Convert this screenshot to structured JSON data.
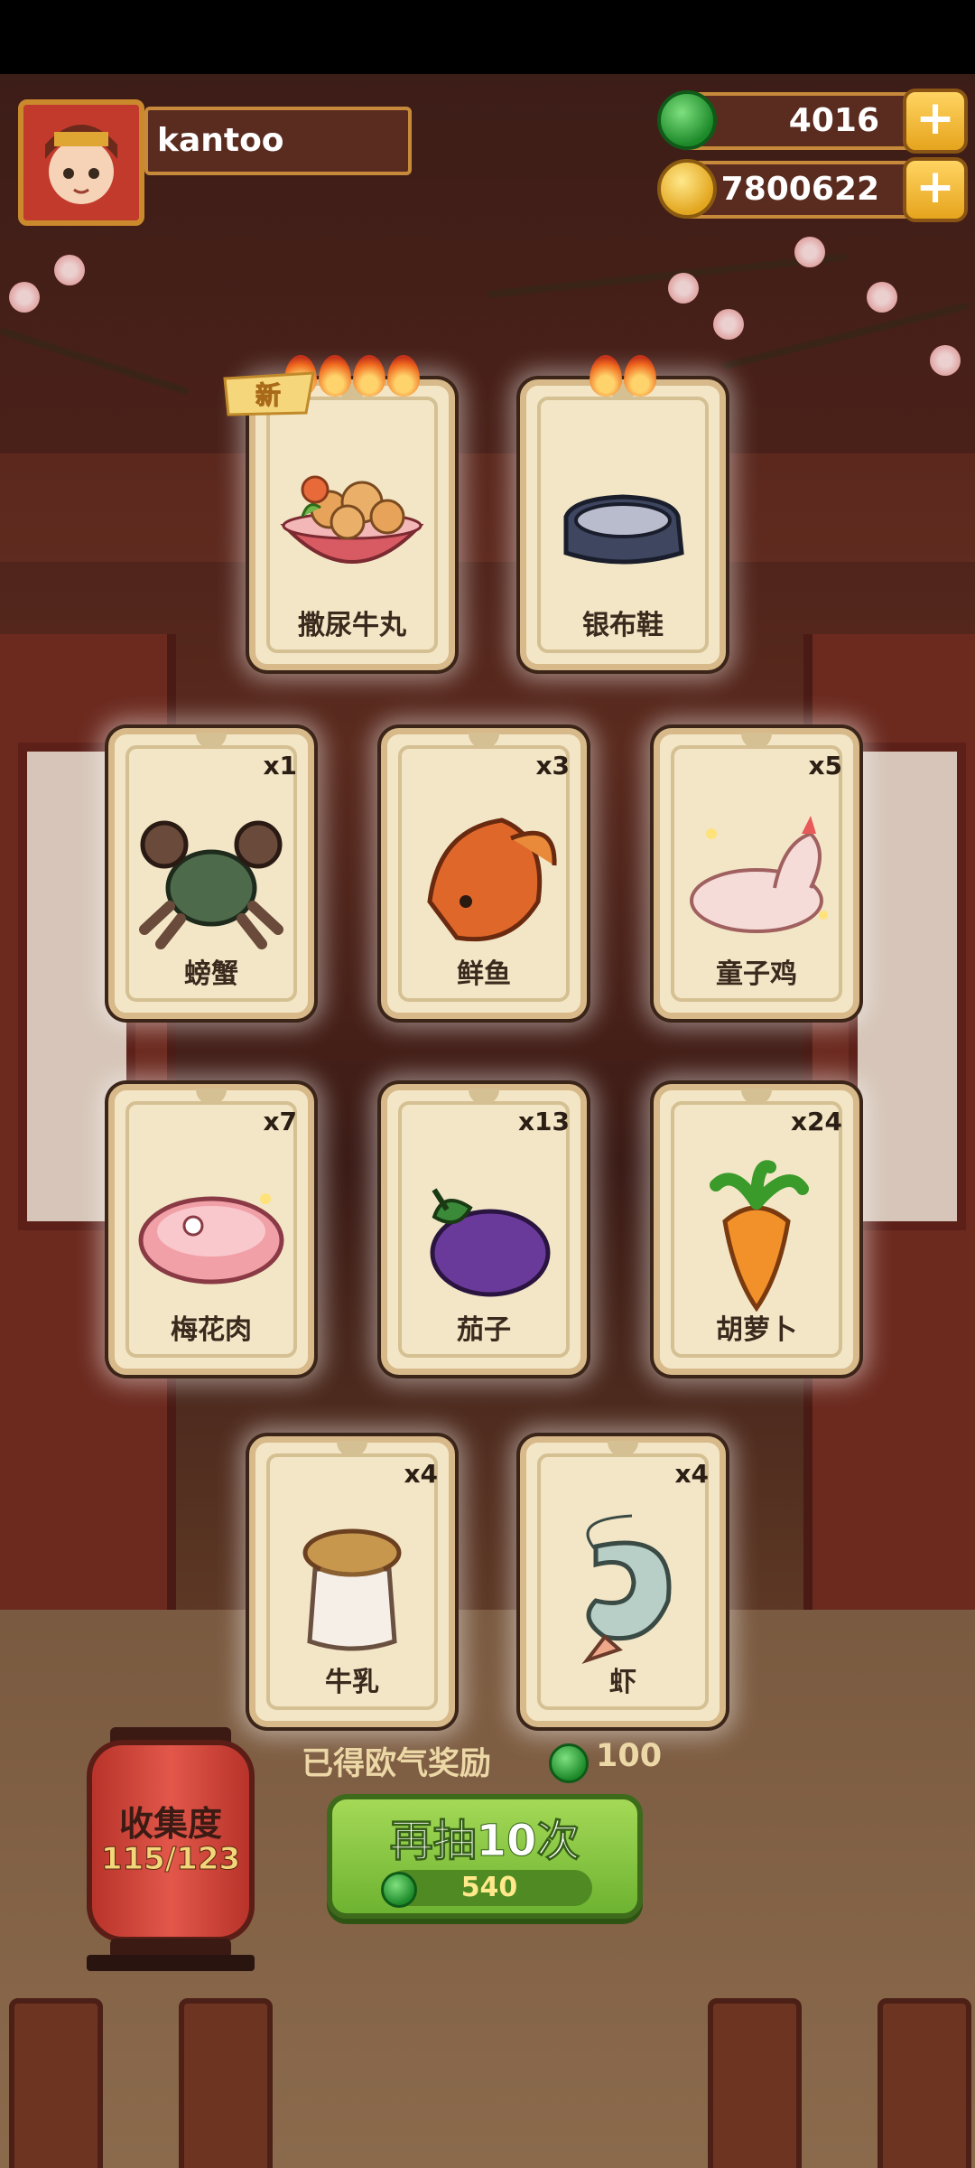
{
  "player": {
    "name": "kantoo"
  },
  "currencies": [
    {
      "name": "jade",
      "value": "4016",
      "icon": "jade-coin-icon",
      "color": "#2fae3a"
    },
    {
      "name": "gold",
      "value": "7800622",
      "icon": "gold-coin-icon",
      "color": "#f0c33c"
    }
  ],
  "top_cards": [
    {
      "label": "撒尿牛丸",
      "flames": 4,
      "is_new": true,
      "new_label": "新",
      "icon": "meatball-bowl-icon"
    },
    {
      "label": "银布鞋",
      "flames": 2,
      "is_new": false,
      "icon": "silver-shoe-icon"
    }
  ],
  "cards": [
    {
      "label": "螃蟹",
      "count": "x1",
      "icon": "crab-icon"
    },
    {
      "label": "鲜鱼",
      "count": "x3",
      "icon": "fish-icon"
    },
    {
      "label": "童子鸡",
      "count": "x5",
      "icon": "chicken-icon"
    },
    {
      "label": "梅花肉",
      "count": "x7",
      "icon": "pork-icon"
    },
    {
      "label": "茄子",
      "count": "x13",
      "icon": "eggplant-icon"
    },
    {
      "label": "胡萝卜",
      "count": "x24",
      "icon": "carrot-icon"
    },
    {
      "label": "牛乳",
      "count": "x4",
      "icon": "milk-jar-icon"
    },
    {
      "label": "虾",
      "count": "x4",
      "icon": "shrimp-icon"
    }
  ],
  "collection": {
    "title": "收集度",
    "progress": "115/123"
  },
  "reward": {
    "text": "已得欧气奖励",
    "value": "100"
  },
  "draw_button": {
    "label": "再抽10次",
    "cost": "540"
  }
}
